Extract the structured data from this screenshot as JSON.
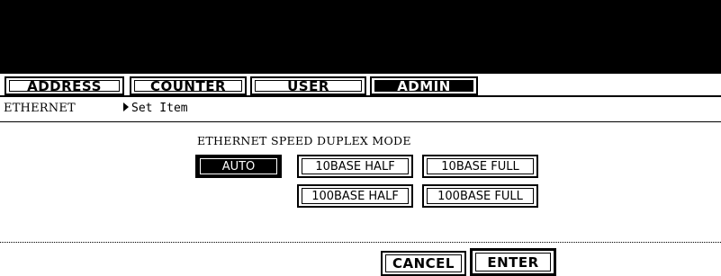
{
  "tabs": [
    {
      "label": "ADDRESS",
      "active": false
    },
    {
      "label": "COUNTER",
      "active": false
    },
    {
      "label": "USER",
      "active": false
    },
    {
      "label": "ADMIN",
      "active": true
    }
  ],
  "header": {
    "section": "ETHERNET",
    "breadcrumb": "Set Item"
  },
  "speed_duplex": {
    "title": "ETHERNET SPEED DUPLEX MODE",
    "options": [
      {
        "label": "AUTO",
        "selected": true
      },
      {
        "label": "10BASE HALF",
        "selected": false
      },
      {
        "label": "10BASE FULL",
        "selected": false
      },
      {
        "label": "100BASE HALF",
        "selected": false
      },
      {
        "label": "100BASE FULL",
        "selected": false
      }
    ]
  },
  "actions": {
    "cancel": "CANCEL",
    "enter": "ENTER"
  }
}
